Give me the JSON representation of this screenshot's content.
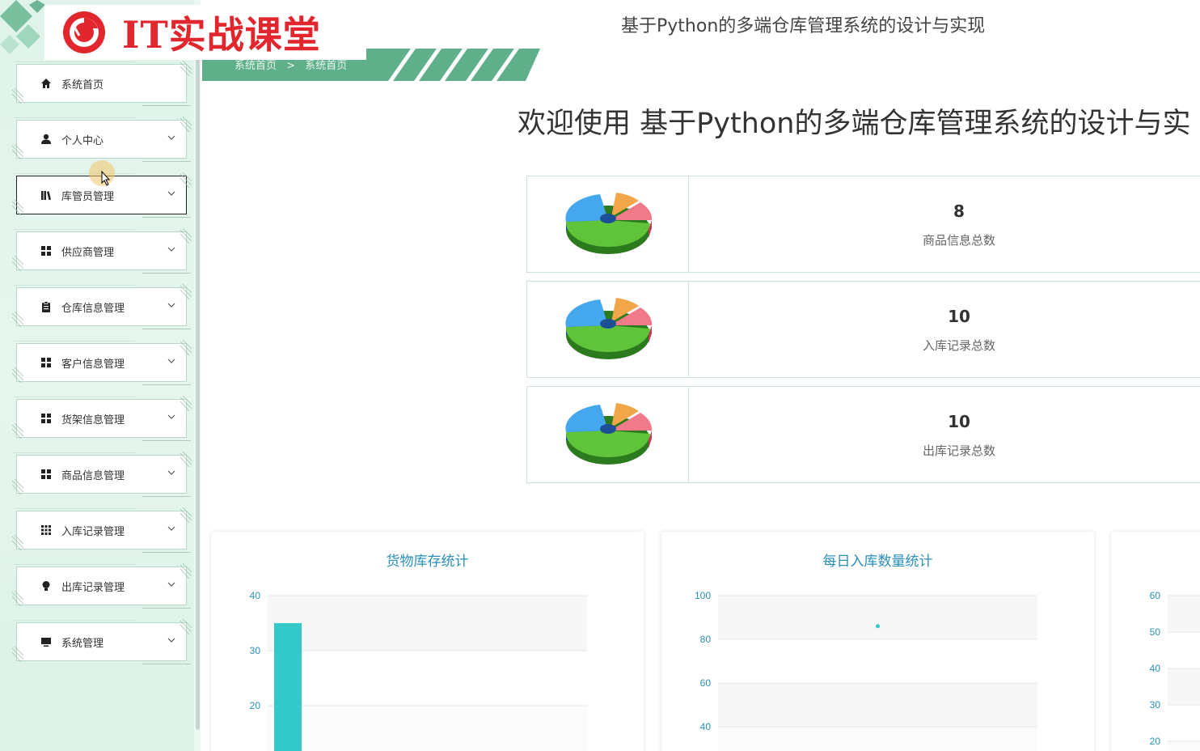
{
  "logo": {
    "text": "IT实战课堂"
  },
  "header": {
    "app_title": "基于Python的多端仓库管理系统的设计与实现"
  },
  "breadcrumb": {
    "home": "系统首页",
    "separator": ">",
    "current": "系统首页"
  },
  "welcome": {
    "text": "欢迎使用 基于Python的多端仓库管理系统的设计与实"
  },
  "sidebar": {
    "items": [
      {
        "label": "系统首页",
        "icon": "home-icon",
        "has_chevron": false
      },
      {
        "label": "个人中心",
        "icon": "user-icon",
        "has_chevron": true
      },
      {
        "label": "库管员管理",
        "icon": "library-icon",
        "has_chevron": true
      },
      {
        "label": "供应商管理",
        "icon": "grid-icon",
        "has_chevron": true
      },
      {
        "label": "仓库信息管理",
        "icon": "clipboard-icon",
        "has_chevron": true
      },
      {
        "label": "客户信息管理",
        "icon": "grid-icon",
        "has_chevron": true
      },
      {
        "label": "货架信息管理",
        "icon": "grid-icon",
        "has_chevron": true
      },
      {
        "label": "商品信息管理",
        "icon": "grid-icon",
        "has_chevron": true
      },
      {
        "label": "入库记录管理",
        "icon": "grid-9-icon",
        "has_chevron": true
      },
      {
        "label": "出库记录管理",
        "icon": "bulb-icon",
        "has_chevron": true
      },
      {
        "label": "系统管理",
        "icon": "monitor-icon",
        "has_chevron": true
      }
    ]
  },
  "stats": [
    {
      "value": "8",
      "label": "商品信息总数",
      "icon": "pie-chart-icon"
    },
    {
      "value": "10",
      "label": "入库记录总数",
      "icon": "pie-chart-icon"
    },
    {
      "value": "10",
      "label": "出库记录总数",
      "icon": "pie-chart-icon"
    }
  ],
  "colors": {
    "accent": "#2a8fb8",
    "bar": "#33c9c9",
    "sidebar_bg": "#dff3ea",
    "brand_red": "#e2262d",
    "breadcrumb_green": "#5fb08a"
  },
  "chart_data": [
    {
      "type": "bar",
      "title": "货物库存统计",
      "y_ticks": [
        40,
        30,
        20
      ],
      "ylim": [
        20,
        40
      ],
      "series": [
        {
          "values": [
            35
          ]
        }
      ],
      "grid": true
    },
    {
      "type": "scatter",
      "title": "每日入库数量统计",
      "y_ticks": [
        100,
        80,
        60,
        40
      ],
      "ylim": [
        40,
        100
      ],
      "series": [
        {
          "values": [
            86
          ]
        }
      ],
      "grid": true
    },
    {
      "type": "bar",
      "title": "",
      "y_ticks": [
        60,
        50,
        40,
        30,
        20
      ],
      "ylim": [
        20,
        60
      ],
      "grid": true
    }
  ]
}
